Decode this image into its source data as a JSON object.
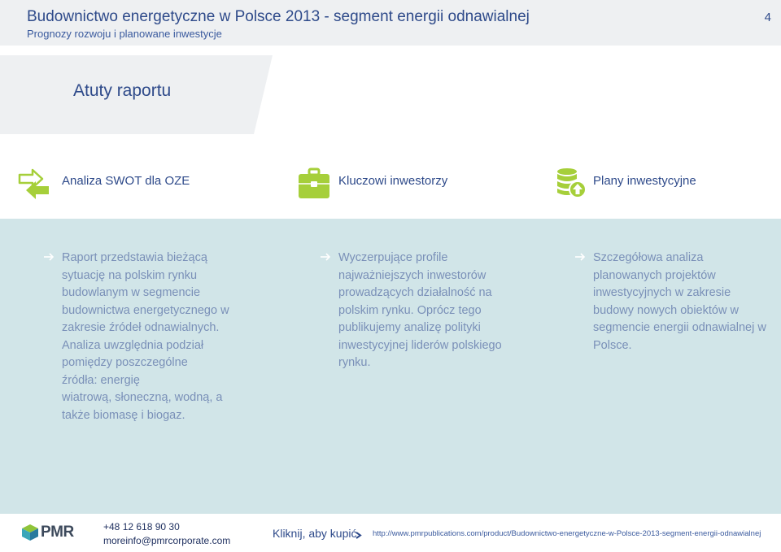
{
  "header": {
    "title": "Budownictwo energetyczne w Polsce 2013 - segment energii odnawialnej",
    "subtitle": "Prognozy rozwoju i planowane inwestycje",
    "page_number": "4"
  },
  "banner": {
    "title": "Atuty raportu"
  },
  "features": [
    {
      "label": "Analiza SWOT dla OZE",
      "icon": "swot-arrows-icon"
    },
    {
      "label": "Kluczowi inwestorzy",
      "icon": "briefcase-icon"
    },
    {
      "label": "Plany inwestycyjne",
      "icon": "database-upload-icon"
    }
  ],
  "columns": [
    {
      "lines": [
        "Raport przedstawia bieżącą",
        "sytuację na polskim rynku",
        "budowlanym w segmencie",
        "budownictwa energetycznego w",
        "zakresie źródeł odnawialnych.",
        "Analiza uwzględnia podział",
        "pomiędzy poszczególne",
        "źródła: energię",
        "wiatrową, słoneczną, wodną, a",
        "także biomasę i biogaz."
      ]
    },
    {
      "lines": [
        "Wyczerpujące profile",
        "najważniejszych inwestorów",
        "prowadzących działalność na",
        "polskim rynku. Oprócz tego",
        "publikujemy analizę polityki",
        "inwestycyjnej liderów polskiego",
        "rynku."
      ]
    },
    {
      "lines": [
        "Szczegółowa analiza",
        "planowanych projektów",
        "inwestycyjnych w zakresie",
        "budowy nowych obiektów w",
        "segmencie energii odnawialnej w",
        "Polsce."
      ]
    }
  ],
  "footer": {
    "logo_text": "PMR",
    "phone": "+48 12 618 90 30",
    "email": "moreinfo@pmrcorporate.com",
    "buy_label": "Kliknij, aby kupić",
    "url": "http://www.pmrpublications.com/product/Budownictwo-energetyczne-w-Polsce-2013-segment-energii-odnawialnej"
  },
  "colors": {
    "title_blue": "#2e4a8a",
    "body_text": "#7a90b8",
    "panel_bg": "#d1e5e8",
    "icon_green": "#a6cf3a"
  }
}
